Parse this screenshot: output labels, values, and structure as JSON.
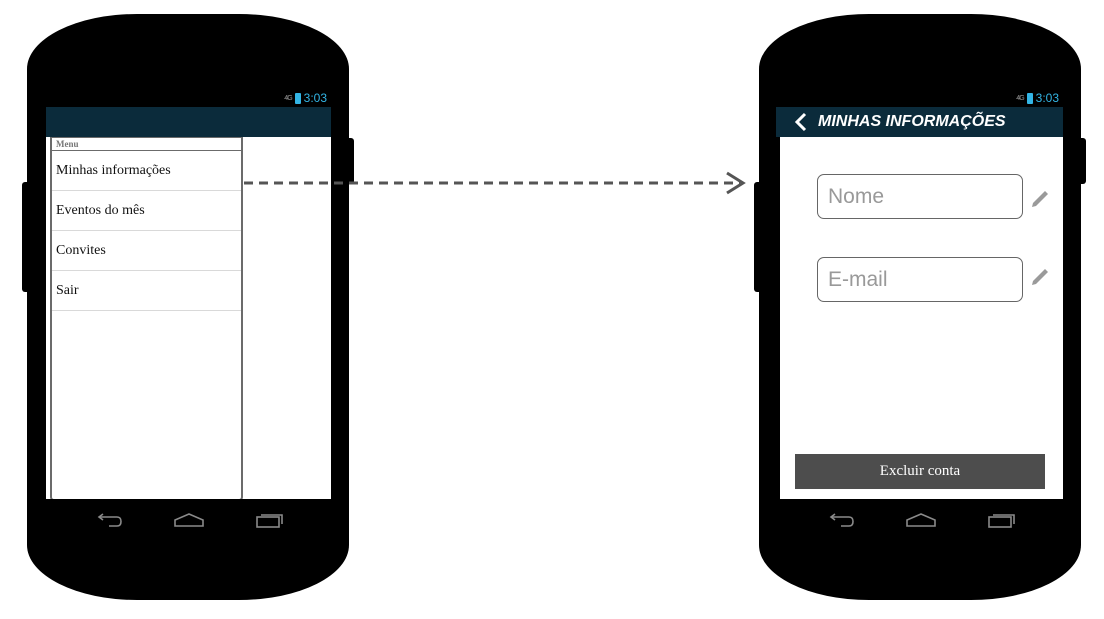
{
  "left_phone": {
    "status_time": "3:03",
    "status_signal": "4G",
    "drawer": {
      "title": "Menu",
      "items": [
        {
          "label": "Minhas informações"
        },
        {
          "label": "Eventos do mês"
        },
        {
          "label": "Convites"
        },
        {
          "label": "Sair"
        }
      ]
    }
  },
  "right_phone": {
    "status_time": "3:03",
    "status_signal": "4G",
    "header": {
      "title": "MINHAS INFORMAÇÕES",
      "back_icon": "chevron-left-icon"
    },
    "fields": [
      {
        "placeholder": "Nome",
        "edit_icon": "pencil-icon"
      },
      {
        "placeholder": "E-mail",
        "edit_icon": "pencil-icon"
      }
    ],
    "delete_button": "Excluir conta"
  },
  "colors": {
    "appbar": "#0b2b3b",
    "status_accent": "#33b5e5",
    "button": "#4d4d4d",
    "arrow": "#555555"
  },
  "nav_icons": [
    "back-icon",
    "home-icon",
    "recents-icon"
  ]
}
